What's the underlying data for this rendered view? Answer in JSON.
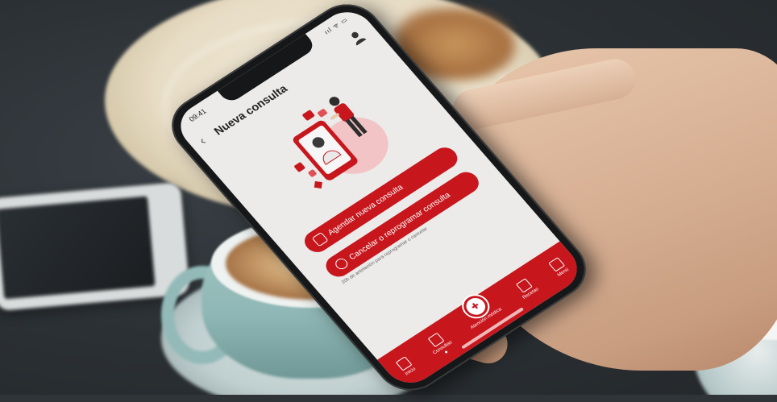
{
  "status_bar": {
    "time": "09:41",
    "icons": "ııl ᯤ ▭"
  },
  "header": {
    "back_icon": "chevron-left-icon",
    "title": "Nueva consulta",
    "profile_icon": "user-icon"
  },
  "actions": [
    {
      "label": "Agendar nueva consulta",
      "icon": "calendar-icon"
    },
    {
      "label": "Cancelar o reprogramar consulta",
      "icon": "clock-icon"
    }
  ],
  "note": "20h de antelación para reprogramar o cancelar",
  "tabbar": {
    "items": [
      {
        "label": "Inicio",
        "icon": "home-icon"
      },
      {
        "label": "Consultas",
        "icon": "calendar-icon",
        "active": true
      },
      {
        "label": "Atención médica",
        "icon": "medical-cross-icon",
        "center": true
      },
      {
        "label": "Recetas",
        "icon": "document-icon"
      },
      {
        "label": "Menú",
        "icon": "menu-icon"
      }
    ]
  },
  "colors": {
    "brand_red": "#c8161d",
    "screen_bg": "#ecebea",
    "illustration_pink": "#f2c4c6"
  }
}
